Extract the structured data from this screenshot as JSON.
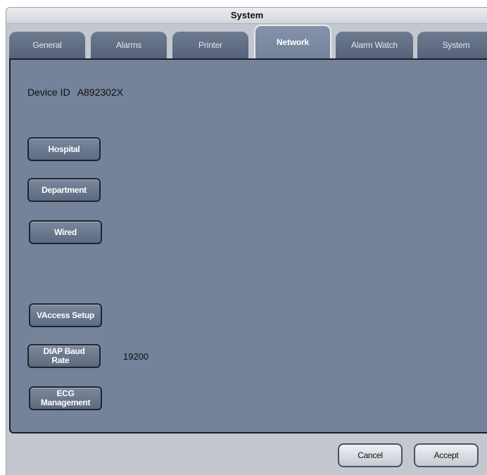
{
  "window": {
    "title": "System"
  },
  "tabs": [
    {
      "label": "General"
    },
    {
      "label": "Alarms"
    },
    {
      "label": "Printer"
    },
    {
      "label": "Network"
    },
    {
      "label": "Alarm Watch"
    },
    {
      "label": "System"
    }
  ],
  "active_tab": "Network",
  "device": {
    "label": "Device ID",
    "value": "A892302X"
  },
  "buttons": {
    "hospital": "Hospital",
    "department": "Department",
    "wired": "Wired",
    "vaccess": "VAccess Setup",
    "diap_line1": "DIAP Baud",
    "diap_line2": "Rate",
    "ecg_line1": "ECG",
    "ecg_line2": "Management"
  },
  "diap_baud_rate": {
    "value": "19200"
  },
  "footer": {
    "cancel": "Cancel",
    "accept": "Accept"
  }
}
